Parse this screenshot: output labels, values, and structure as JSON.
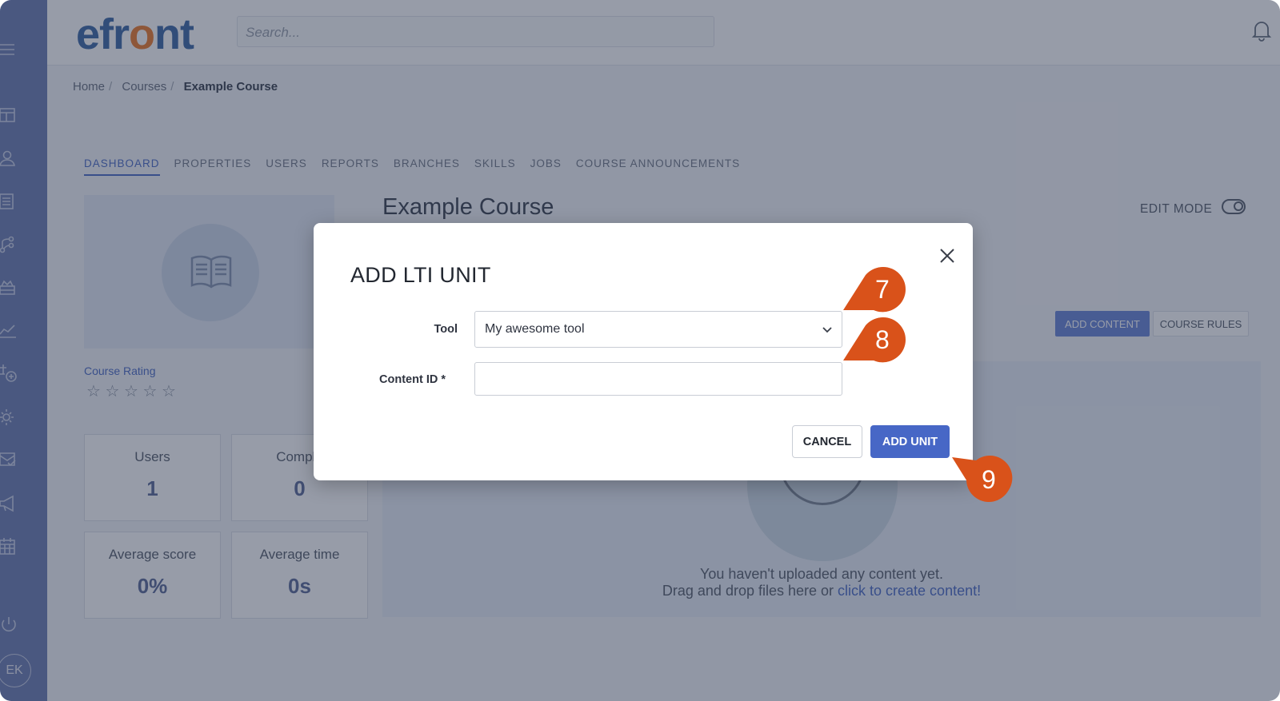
{
  "app": {
    "logo_text_pre": "efr",
    "logo_text_o": "o",
    "logo_text_post": "nt",
    "search_placeholder": "Search..."
  },
  "sidebar": {
    "avatar_initials": "EK"
  },
  "breadcrumb": {
    "items": [
      "Home",
      "Courses",
      "Example Course"
    ]
  },
  "tabs": [
    "DASHBOARD",
    "PROPERTIES",
    "USERS",
    "REPORTS",
    "BRANCHES",
    "SKILLS",
    "JOBS",
    "COURSE ANNOUNCEMENTS"
  ],
  "course": {
    "title": "Example Course",
    "rating_label": "Course Rating",
    "stars": "☆ ☆ ☆ ☆ ☆",
    "edit_mode_label": "EDIT MODE",
    "add_content_label": "ADD CONTENT",
    "course_rules_label": "COURSE RULES",
    "empty_line1": "You haven't uploaded any content yet.",
    "empty_line2_prefix": "Drag and drop files here or ",
    "empty_link": "click to create content!"
  },
  "stats": [
    {
      "label": "Users",
      "value": "1"
    },
    {
      "label": "Comple",
      "value": "0"
    },
    {
      "label": "Average score",
      "value": "0%"
    },
    {
      "label": "Average time",
      "value": "0s"
    }
  ],
  "modal": {
    "title": "ADD LTI UNIT",
    "tool_label": "Tool",
    "tool_value": "My awesome tool",
    "content_id_label": "Content ID *",
    "content_id_value": "",
    "cancel_label": "CANCEL",
    "add_unit_label": "ADD UNIT"
  },
  "callouts": [
    "7",
    "8",
    "9"
  ],
  "colors": {
    "accent": "#4767c6",
    "callout": "#d9521a",
    "sidebar": "#6f7fb3",
    "logo_blue": "#3f6aa6",
    "logo_orange": "#ee7d2e"
  }
}
